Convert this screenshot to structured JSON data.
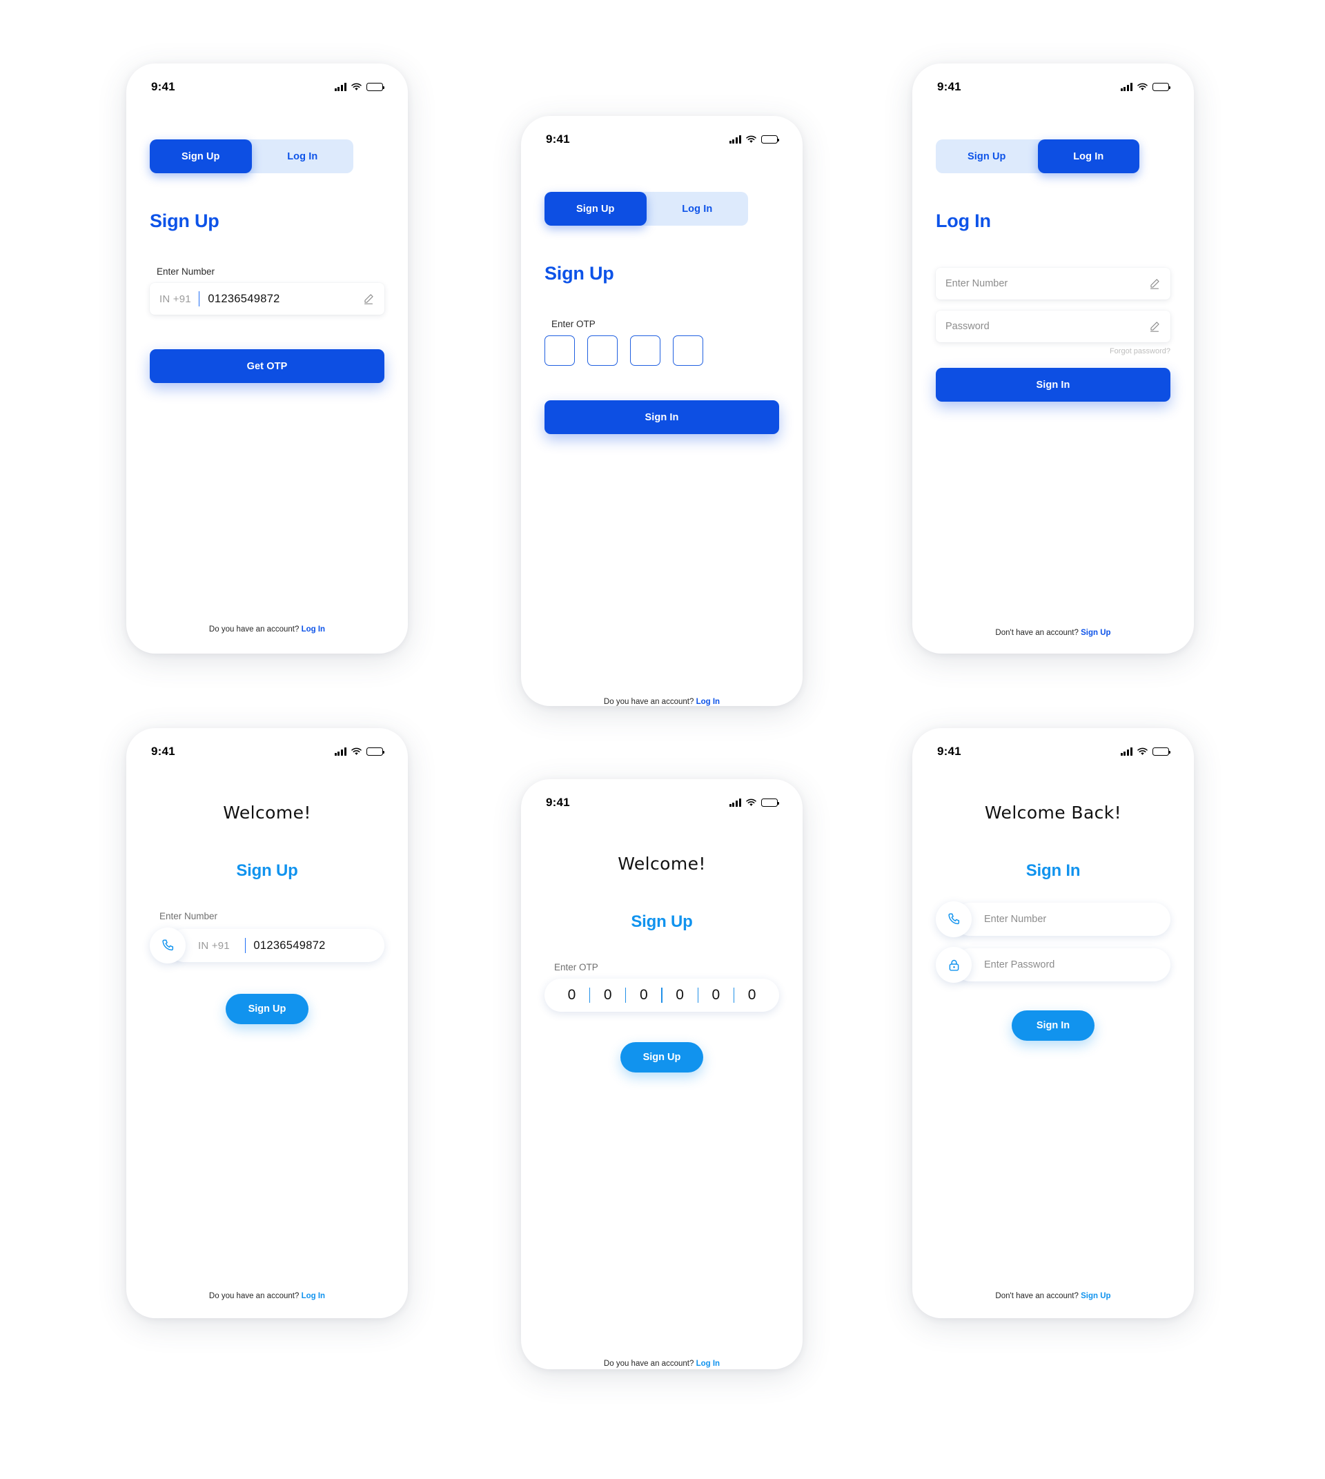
{
  "meta": {
    "status_time": "9:41",
    "colors": {
      "primary_blue": "#0D4FE3",
      "primary_blue_text": "#0D53E8",
      "tab_track_light": "#DDEAFC",
      "accent_light_blue": "#1193EE",
      "placeholder_grey": "#8C8C8C",
      "forgot_grey": "#BDBDBD"
    },
    "icons": {
      "signal": "signal-bars-icon",
      "wifi": "wifi-icon",
      "battery": "battery-full-icon",
      "pencil": "pencil-edit-icon",
      "phone": "phone-icon",
      "lock": "lock-icon"
    }
  },
  "screens": [
    {
      "id": "signup-number",
      "tabs": {
        "signup": "Sign Up",
        "login": "Log In",
        "active": "signup"
      },
      "heading": "Sign Up",
      "number_label": "Enter Number",
      "country_code": "IN +91",
      "number_value": "01236549872",
      "primary_button": "Get OTP",
      "footer_text": "Do you have an account?",
      "footer_link": "Log In"
    },
    {
      "id": "signup-otp",
      "tabs": {
        "signup": "Sign Up",
        "login": "Log In",
        "active": "signup"
      },
      "heading": "Sign Up",
      "otp_label": "Enter OTP",
      "otp_boxes": [
        "",
        "",
        "",
        ""
      ],
      "primary_button": "Sign In",
      "footer_text": "Do you have an account?",
      "footer_link": "Log In"
    },
    {
      "id": "login",
      "tabs": {
        "signup": "Sign Up",
        "login": "Log In",
        "active": "login"
      },
      "heading": "Log In",
      "number_placeholder": "Enter Number",
      "password_placeholder": "Password",
      "forgot_password": "Forgot password?",
      "primary_button": "Sign In",
      "footer_text": "Don't have an account?",
      "footer_link": "Sign Up"
    },
    {
      "id": "welcome-signup-number",
      "welcome": "Welcome!",
      "subheading": "Sign Up",
      "number_label": "Enter Number",
      "country_code": "IN +91",
      "number_value": "01236549872",
      "primary_button": "Sign Up",
      "footer_text": "Do you have an account?",
      "footer_link": "Log In"
    },
    {
      "id": "welcome-signup-otp",
      "welcome": "Welcome!",
      "subheading": "Sign Up",
      "otp_label": "Enter OTP",
      "otp_digits": [
        "0",
        "0",
        "0",
        "0",
        "0",
        "0"
      ],
      "primary_button": "Sign Up",
      "footer_text": "Do you have an account?",
      "footer_link": "Log In"
    },
    {
      "id": "welcome-back-signin",
      "welcome": "Welcome Back!",
      "subheading": "Sign In",
      "number_placeholder": "Enter Number",
      "password_placeholder": "Enter Password",
      "primary_button": "Sign In",
      "footer_text": "Don't have an account?",
      "footer_link": "Sign Up"
    }
  ]
}
